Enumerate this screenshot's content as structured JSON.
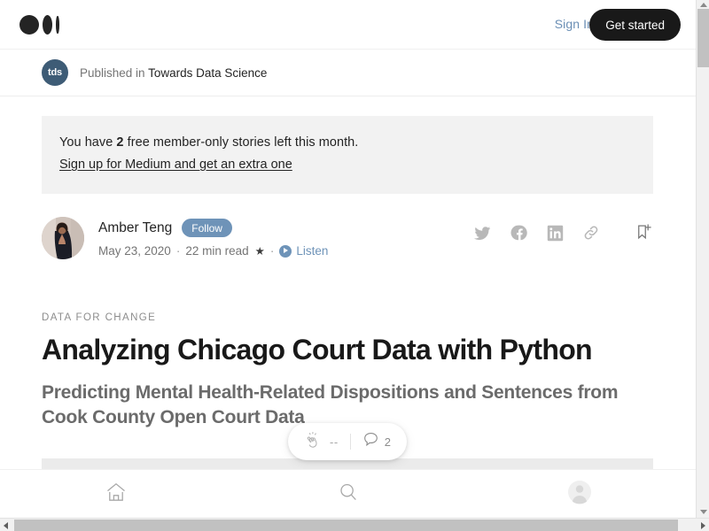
{
  "topbar": {
    "logo_name": "medium-logo",
    "signin_label": "Sign In",
    "getstarted_label": "Get started",
    "getstarted_bg": "#191919"
  },
  "publication": {
    "avatar_text": "tds",
    "avatar_bg": "#3e5c76",
    "prefix": "Published in ",
    "name": "Towards Data Science"
  },
  "notice": {
    "text_before": "You have ",
    "count": "2",
    "text_after": " free member-only stories left this month.",
    "link_label": "Sign up for Medium and get an extra one",
    "bg": "#f2f2f2"
  },
  "byline": {
    "author_name": "Amber Teng",
    "follow_label": "Follow",
    "follow_bg": "#6e93b8",
    "date": "May 23, 2020",
    "separator": "·",
    "read_time": "22 min read",
    "star_glyph": "★",
    "listen_label": "Listen",
    "listen_color": "#6e93b8",
    "share": [
      {
        "name": "twitter-icon"
      },
      {
        "name": "facebook-icon"
      },
      {
        "name": "linkedin-icon"
      },
      {
        "name": "link-icon"
      },
      {
        "name": "bookmark-add-icon"
      }
    ]
  },
  "article": {
    "kicker": "DATA FOR CHANGE",
    "headline": "Analyzing Chicago Court Data with Python",
    "subhead": "Predicting Mental Health-Related Dispositions and Sentences from Cook County Open Court Data"
  },
  "engagement": {
    "clap_icon": "clap-icon",
    "clap_count": "--",
    "comment_icon": "comment-icon",
    "comment_count": "2"
  },
  "bottomnav": {
    "items": [
      {
        "name": "home-icon"
      },
      {
        "name": "search-icon"
      },
      {
        "name": "profile-avatar-icon"
      }
    ]
  }
}
